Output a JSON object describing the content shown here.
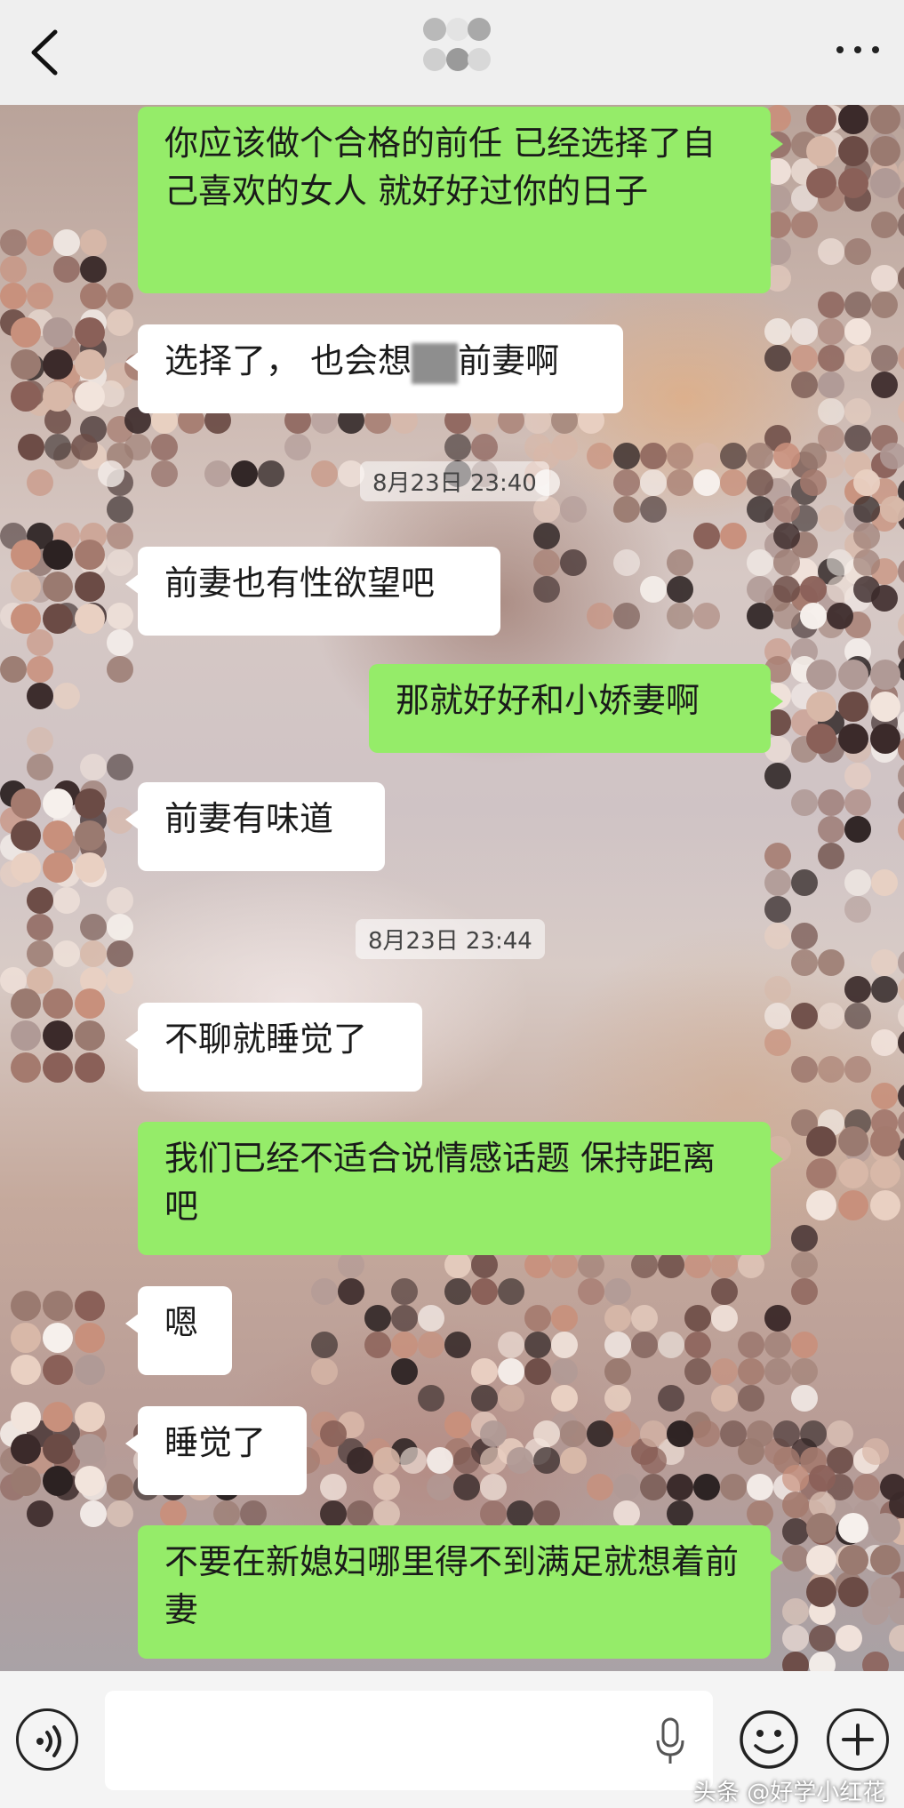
{
  "header": {
    "title": "",
    "more_label": "···"
  },
  "colors": {
    "sent_bubble": "#95ec69",
    "recv_bubble": "#ffffff",
    "background": "#ededed"
  },
  "messages": [
    {
      "side": "sent",
      "text": "你应该做个合格的前任  已经选择了自己喜欢的女人 就好好过你的日子"
    },
    {
      "side": "recv",
      "text_before": "选择了， 也会想",
      "text_after": "前妻啊"
    },
    {
      "side": "recv",
      "text": "前妻也有性欲望吧"
    },
    {
      "side": "sent",
      "text": "那就好好和小娇妻啊"
    },
    {
      "side": "recv",
      "text": "前妻有味道"
    },
    {
      "side": "recv",
      "text": "不聊就睡觉了"
    },
    {
      "side": "sent",
      "text": "我们已经不适合说情感话题  保持距离吧"
    },
    {
      "side": "recv",
      "text": "嗯"
    },
    {
      "side": "recv",
      "text": "睡觉了"
    },
    {
      "side": "sent",
      "text": "不要在新媳妇哪里得不到满足就想着前妻"
    }
  ],
  "timestamps": [
    "8月23日 23:40",
    "8月23日 23:44"
  ],
  "input": {
    "placeholder": ""
  },
  "icons": [
    "back-arrow-icon",
    "more-icon",
    "voice-icon",
    "microphone-icon",
    "emoji-icon",
    "plus-icon"
  ],
  "watermark": "头条 @好学小红花"
}
